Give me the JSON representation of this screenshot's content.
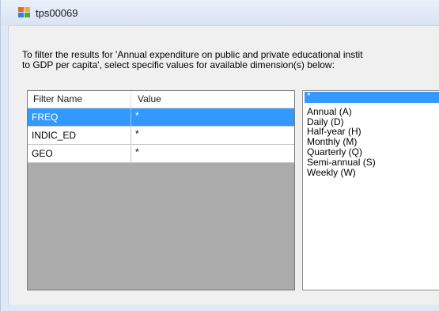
{
  "window": {
    "title": "tps00069"
  },
  "description": {
    "line1": "To filter the results for 'Annual expenditure on public and private educational instit",
    "line2": "to GDP per capita', select specific values for available dimension(s) below:"
  },
  "grid": {
    "headers": {
      "name": "Filter Name",
      "value": "Value"
    },
    "rows": [
      {
        "name": "FREQ",
        "value": "*",
        "selected": true
      },
      {
        "name": "INDIC_ED",
        "value": "*",
        "selected": false
      },
      {
        "name": "GEO",
        "value": "*",
        "selected": false
      }
    ]
  },
  "listbox": {
    "items": [
      {
        "label": "*",
        "selected": true
      },
      {
        "label": "Annual (A)",
        "selected": false
      },
      {
        "label": "Daily (D)",
        "selected": false
      },
      {
        "label": "Half-year (H)",
        "selected": false
      },
      {
        "label": "Monthly (M)",
        "selected": false
      },
      {
        "label": "Quarterly (Q)",
        "selected": false
      },
      {
        "label": "Semi-annual (S)",
        "selected": false
      },
      {
        "label": "Weekly (W)",
        "selected": false
      }
    ]
  },
  "colors": {
    "selection": "#3399ff",
    "chrome": "#dfe8f5",
    "grid_empty": "#ababab"
  }
}
